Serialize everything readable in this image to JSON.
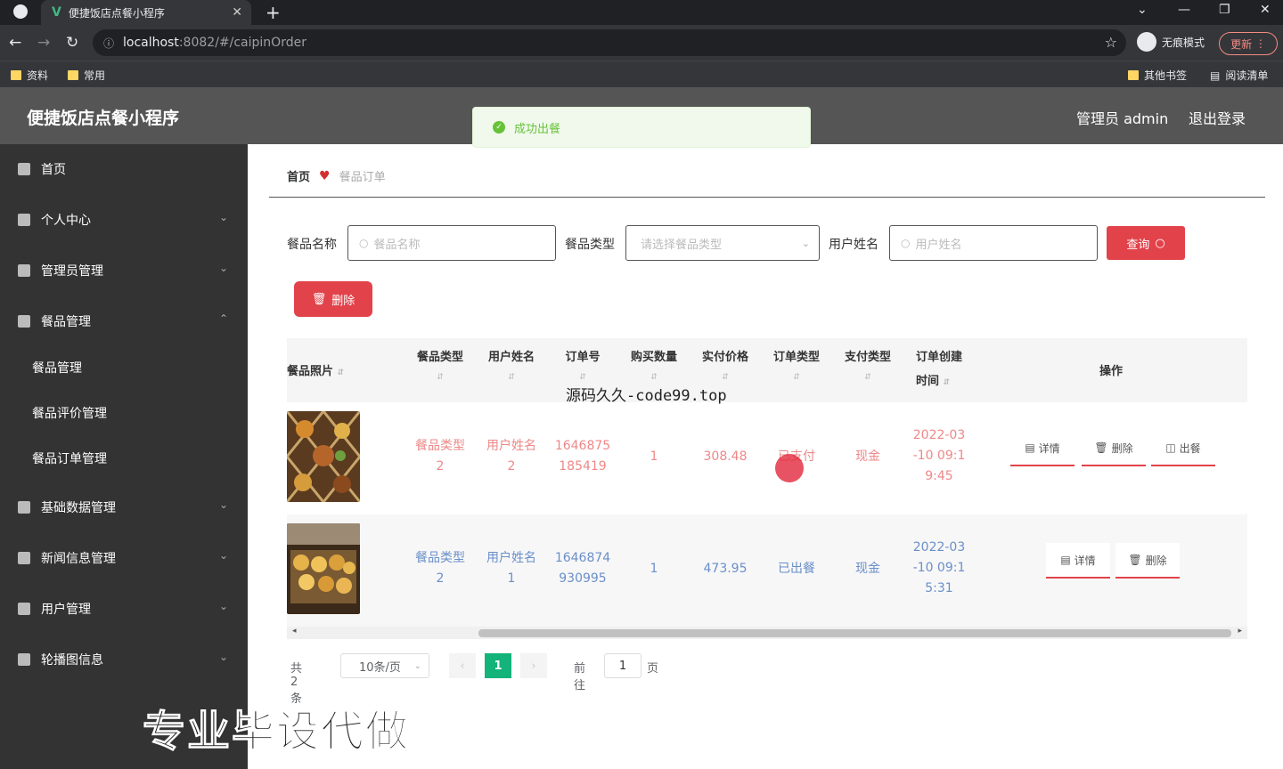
{
  "browser": {
    "tab_title": "便捷饭店点餐小程序",
    "tab_favicon": "V",
    "url_host": "localhost",
    "url_rest": ":8082/#/caipinOrder",
    "incognito_label": "无痕模式",
    "update_label": "更新",
    "bookmarks": [
      "资料",
      "常用"
    ],
    "bookmarks_right": [
      "其他书签",
      "阅读清单"
    ]
  },
  "header": {
    "app_title": "便捷饭店点餐小程序",
    "admin_label": "管理员 admin",
    "logout_label": "退出登录"
  },
  "toast": {
    "message": "成功出餐",
    "color": "#67c23a"
  },
  "sidebar": {
    "items": [
      {
        "label": "首页"
      },
      {
        "label": "个人中心"
      },
      {
        "label": "管理员管理"
      },
      {
        "label": "餐品管理"
      },
      {
        "label": "餐品管理"
      },
      {
        "label": "餐品评价管理"
      },
      {
        "label": "餐品订单管理"
      },
      {
        "label": "基础数据管理"
      },
      {
        "label": "新闻信息管理"
      },
      {
        "label": "用户管理"
      },
      {
        "label": "轮播图信息"
      }
    ]
  },
  "breadcrumb": {
    "home": "首页",
    "current": "餐品订单"
  },
  "filters": {
    "name_label": "餐品名称",
    "name_placeholder": "餐品名称",
    "type_label": "餐品类型",
    "type_placeholder": "请选择餐品类型",
    "user_label": "用户姓名",
    "user_placeholder": "用户姓名",
    "query_label": "查询"
  },
  "actions": {
    "delete_label": "删除"
  },
  "table": {
    "headers": [
      "餐品照片",
      "餐品类型",
      "用户姓名",
      "订单号",
      "购买数量",
      "实付价格",
      "订单类型",
      "支付类型",
      "订单创建",
      "时间",
      "操作"
    ],
    "rows": [
      {
        "type": [
          "餐品类型",
          "2"
        ],
        "user": [
          "用户姓名",
          "2"
        ],
        "order_no": [
          "1646875",
          "185419"
        ],
        "qty": "1",
        "price": "308.48",
        "order_type": "已支付",
        "pay_type": "现金",
        "created": [
          "2022-03",
          "-10 09:1",
          "9:45"
        ],
        "ops": [
          "详情",
          "删除",
          "出餐"
        ]
      },
      {
        "type": [
          "餐品类型",
          "2"
        ],
        "user": [
          "用户姓名",
          "1"
        ],
        "order_no": [
          "1646874",
          "930995"
        ],
        "qty": "1",
        "price": "473.95",
        "order_type": "已出餐",
        "pay_type": "现金",
        "created": [
          "2022-03",
          "-10 09:1",
          "5:31"
        ],
        "ops": [
          "详情",
          "删除"
        ]
      }
    ]
  },
  "pagination": {
    "total": "共 2 条",
    "page_size": "10条/页",
    "current": "1",
    "goto_label": "前往",
    "goto_value": "1",
    "page_suffix": "页"
  },
  "overlays": {
    "code_text": "源码久久-code99.top",
    "big_text": "专业毕设代做"
  },
  "colors": {
    "accent_red": "#e2434b",
    "active_page": "#13b37a",
    "sidebar_bg": "#333333"
  }
}
